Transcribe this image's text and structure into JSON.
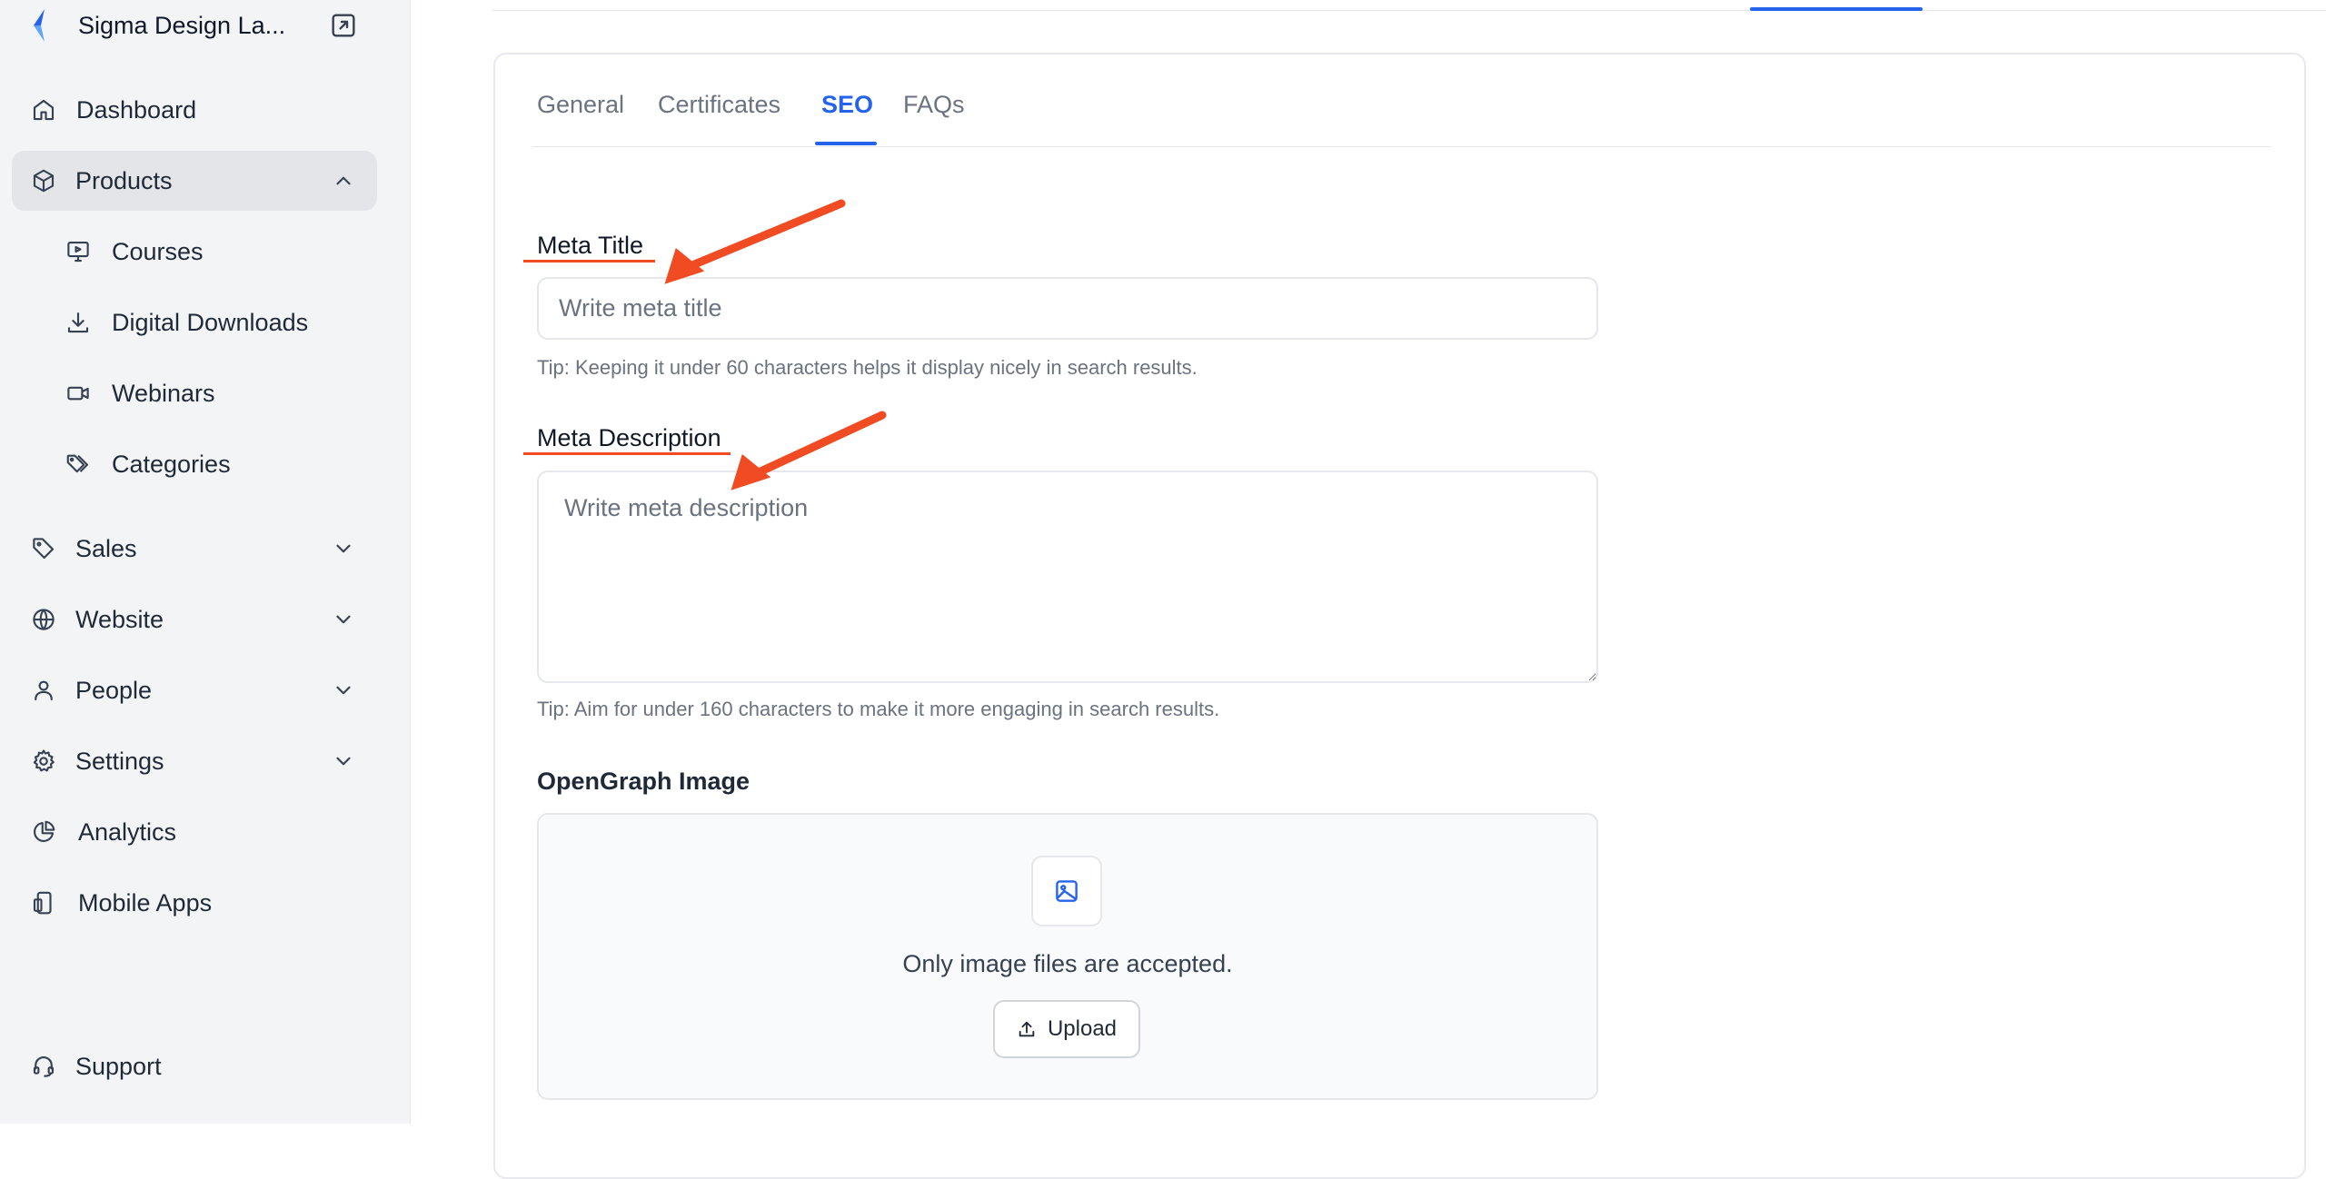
{
  "sidebar": {
    "brand": {
      "name": "Sigma Design La...",
      "logo_icon": "brand-logo-icon",
      "external_icon": "external-link-icon",
      "accent": "#2563eb"
    },
    "items": [
      {
        "key": "dashboard",
        "label": "Dashboard",
        "icon": "home-icon",
        "active": false,
        "expandable": false
      },
      {
        "key": "products",
        "label": "Products",
        "icon": "cube-icon",
        "active": true,
        "expandable": true,
        "expanded": true
      },
      {
        "key": "courses",
        "label": "Courses",
        "icon": "presentation-icon",
        "sub": true
      },
      {
        "key": "digital-downloads",
        "label": "Digital Downloads",
        "icon": "download-icon",
        "sub": true
      },
      {
        "key": "webinars",
        "label": "Webinars",
        "icon": "video-icon",
        "sub": true
      },
      {
        "key": "categories",
        "label": "Categories",
        "icon": "tags-icon",
        "sub": true
      },
      {
        "key": "sales",
        "label": "Sales",
        "icon": "tag-icon",
        "expandable": true,
        "expanded": false
      },
      {
        "key": "website",
        "label": "Website",
        "icon": "globe-icon",
        "expandable": true,
        "expanded": false
      },
      {
        "key": "people",
        "label": "People",
        "icon": "user-icon",
        "expandable": true,
        "expanded": false
      },
      {
        "key": "settings",
        "label": "Settings",
        "icon": "gear-icon",
        "expandable": true,
        "expanded": false
      },
      {
        "key": "analytics",
        "label": "Analytics",
        "icon": "pie-chart-icon"
      },
      {
        "key": "mobile-apps",
        "label": "Mobile Apps",
        "icon": "mobile-icon"
      },
      {
        "key": "support",
        "label": "Support",
        "icon": "headset-icon"
      }
    ]
  },
  "tabs": [
    {
      "label": "General",
      "active": false
    },
    {
      "label": "Certificates",
      "active": false
    },
    {
      "label": "SEO",
      "active": true
    },
    {
      "label": "FAQs",
      "active": false
    }
  ],
  "seo": {
    "meta_title": {
      "label": "Meta Title",
      "placeholder": "Write meta title",
      "value": "",
      "tip": "Tip: Keeping it under 60 characters helps it display nicely in search results."
    },
    "meta_description": {
      "label": "Meta Description",
      "placeholder": "Write meta description",
      "value": "",
      "tip": "Tip: Aim for under 160 characters to make it more engaging in search results."
    },
    "og_image": {
      "label": "OpenGraph Image",
      "icon": "image-icon",
      "hint": "Only image files are accepted.",
      "upload_label": "Upload",
      "upload_icon": "upload-icon"
    }
  },
  "colors": {
    "accent": "#2563eb",
    "annotation": "#f04b23",
    "sidebar_bg": "#f3f4f6",
    "active_item_bg": "#e4e5e8"
  }
}
